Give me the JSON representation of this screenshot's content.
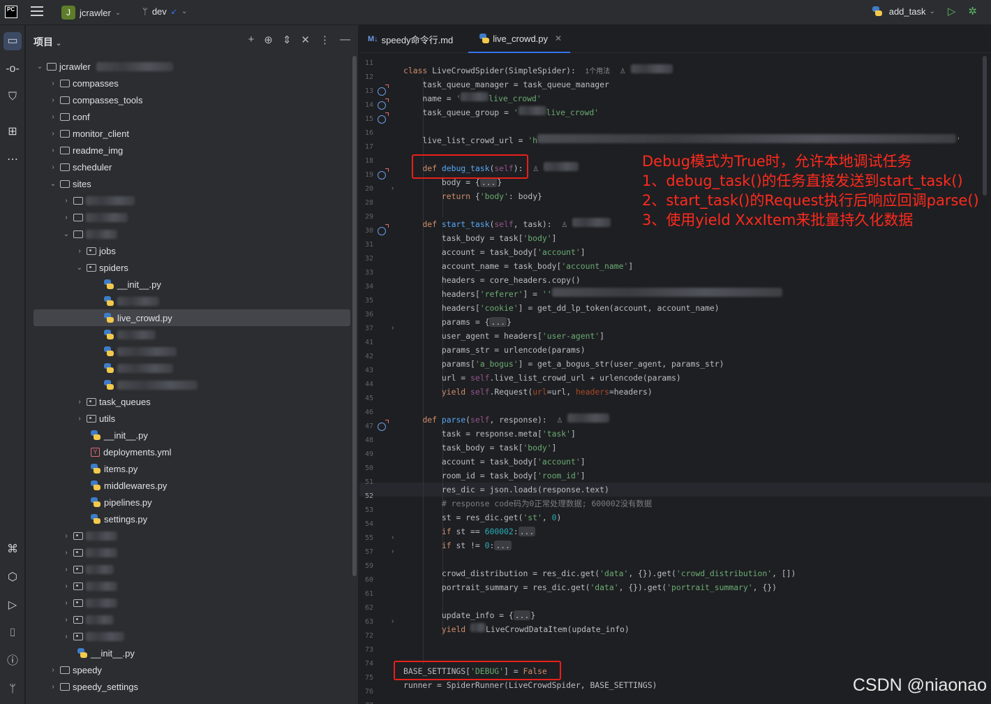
{
  "topbar": {
    "logo": "PC",
    "project_badge": "J",
    "project_name": "jcrawler",
    "branch": "dev",
    "run_config": "add_task"
  },
  "toolstrip": {
    "icons": [
      "folder-icon",
      "commit-icon",
      "structure-icon",
      "bookmarks-icon",
      "more-icon",
      "python-console-icon",
      "python-packages-icon",
      "services-icon",
      "terminal-icon",
      "problems-icon",
      "git-icon"
    ]
  },
  "project_panel": {
    "title": "项目",
    "tree": [
      {
        "label": "jcrawler",
        "kind": "folder",
        "open": true
      },
      {
        "label": "compasses",
        "kind": "folder"
      },
      {
        "label": "compasses_tools",
        "kind": "folder"
      },
      {
        "label": "conf",
        "kind": "folder"
      },
      {
        "label": "monitor_client",
        "kind": "folder"
      },
      {
        "label": "readme_img",
        "kind": "folder"
      },
      {
        "label": "scheduler",
        "kind": "folder"
      },
      {
        "label": "sites",
        "kind": "folder",
        "open": true
      },
      {
        "label": "",
        "kind": "folder"
      },
      {
        "label": "",
        "kind": "folder"
      },
      {
        "label": "",
        "kind": "folder",
        "open": true
      },
      {
        "label": "jobs",
        "kind": "pkg"
      },
      {
        "label": "spiders",
        "kind": "pkg",
        "open": true
      },
      {
        "label": "__init__.py",
        "kind": "py"
      },
      {
        "label": "",
        "kind": "py"
      },
      {
        "label": "live_crowd.py",
        "kind": "py",
        "selected": true
      },
      {
        "label": "",
        "kind": "py"
      },
      {
        "label": "",
        "kind": "py"
      },
      {
        "label": "",
        "kind": "py"
      },
      {
        "label": "",
        "kind": "py"
      },
      {
        "label": "task_queues",
        "kind": "pkg"
      },
      {
        "label": "utils",
        "kind": "pkg"
      },
      {
        "label": "__init__.py",
        "kind": "py"
      },
      {
        "label": "deployments.yml",
        "kind": "yml"
      },
      {
        "label": "items.py",
        "kind": "py"
      },
      {
        "label": "middlewares.py",
        "kind": "py"
      },
      {
        "label": "pipelines.py",
        "kind": "py"
      },
      {
        "label": "settings.py",
        "kind": "py"
      },
      {
        "label": "",
        "kind": "pkg"
      },
      {
        "label": "",
        "kind": "pkg"
      },
      {
        "label": "",
        "kind": "pkg"
      },
      {
        "label": "",
        "kind": "pkg"
      },
      {
        "label": "",
        "kind": "pkg"
      },
      {
        "label": "",
        "kind": "pkg"
      },
      {
        "label": "",
        "kind": "pkg"
      },
      {
        "label": "__init__.py",
        "kind": "py"
      },
      {
        "label": "speedy",
        "kind": "folder"
      },
      {
        "label": "speedy_settings",
        "kind": "folder"
      }
    ]
  },
  "editor": {
    "tabs": [
      {
        "label": "speedy命令行.md",
        "icon": "M↓"
      },
      {
        "label": "live_crowd.py",
        "active": true
      }
    ],
    "line_numbers": [
      "11",
      "12",
      "13",
      "14",
      "15",
      "16",
      "17",
      "18",
      "19",
      "20",
      "28",
      "29",
      "30",
      "31",
      "32",
      "33",
      "34",
      "35",
      "36",
      "37",
      "41",
      "42",
      "43",
      "44",
      "45",
      "46",
      "47",
      "48",
      "49",
      "50",
      "51",
      "52",
      "53",
      "54",
      "55",
      "57",
      "59",
      "60",
      "61",
      "62",
      "63",
      "72",
      "73",
      "74",
      "75",
      "76",
      "77"
    ],
    "current_line": "52",
    "hints": {
      "usages": "1个用法"
    },
    "annotation": {
      "lines": [
        "Debug模式为True时，允许本地调试任务",
        "1、debug_task()的任务直接发送到start_task()",
        "2、start_task()的Request执行后响应回调parse()",
        "3、使用yield XxxItem来批量持久化数据"
      ]
    },
    "watermark": "CSDN @niaonao"
  }
}
